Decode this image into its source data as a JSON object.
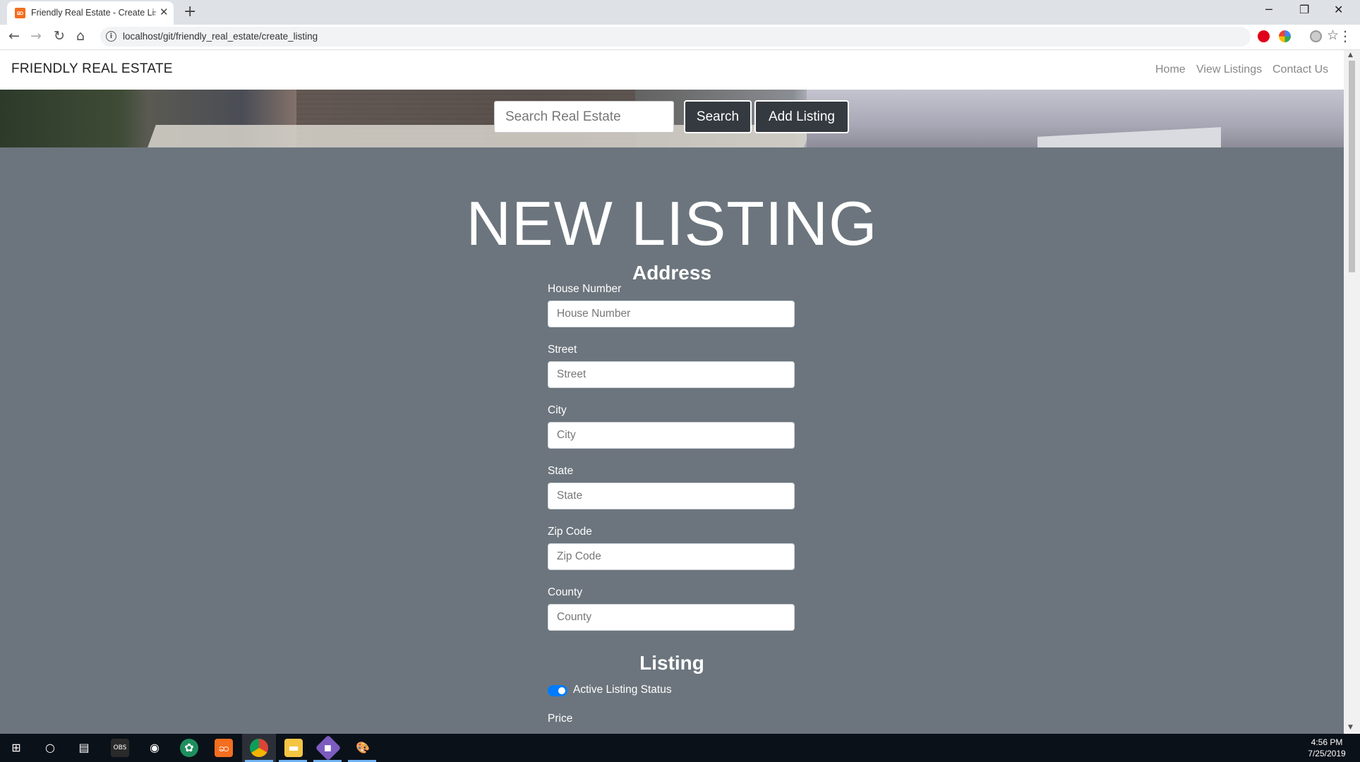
{
  "browser": {
    "tab_title": "Friendly Real Estate - Create Listing",
    "tab_close": "✕",
    "new_tab": "+",
    "url": "localhost/git/friendly_real_estate/create_listing",
    "minimize": "─",
    "restore": "❐",
    "close": "✕",
    "back": "←",
    "forward": "→",
    "reload": "↻",
    "home": "⌂",
    "star": "☆",
    "menu": "⋮"
  },
  "navbar": {
    "brand": "FRIENDLY REAL ESTATE",
    "links": [
      "Home",
      "View Listings",
      "Contact Us"
    ]
  },
  "hero": {
    "search_placeholder": "Search Real Estate",
    "search_button": "Search",
    "add_button": "Add Listing"
  },
  "page": {
    "title": "NEW LISTING",
    "address_heading": "Address",
    "fields": [
      {
        "label": "House Number",
        "placeholder": "House Number"
      },
      {
        "label": "Street",
        "placeholder": "Street"
      },
      {
        "label": "City",
        "placeholder": "City"
      },
      {
        "label": "State",
        "placeholder": "State"
      },
      {
        "label": "Zip Code",
        "placeholder": "Zip Code"
      },
      {
        "label": "County",
        "placeholder": "County"
      }
    ],
    "listing_heading": "Listing",
    "active_toggle_label": "Active Listing Status",
    "active_toggle_on": true,
    "price_label": "Price"
  },
  "taskbar": {
    "time": "4:56 PM",
    "date": "7/25/2019"
  },
  "colors": {
    "page_bg": "#6c757d",
    "button_dark": "#343a40",
    "toggle_on": "#007bff"
  }
}
